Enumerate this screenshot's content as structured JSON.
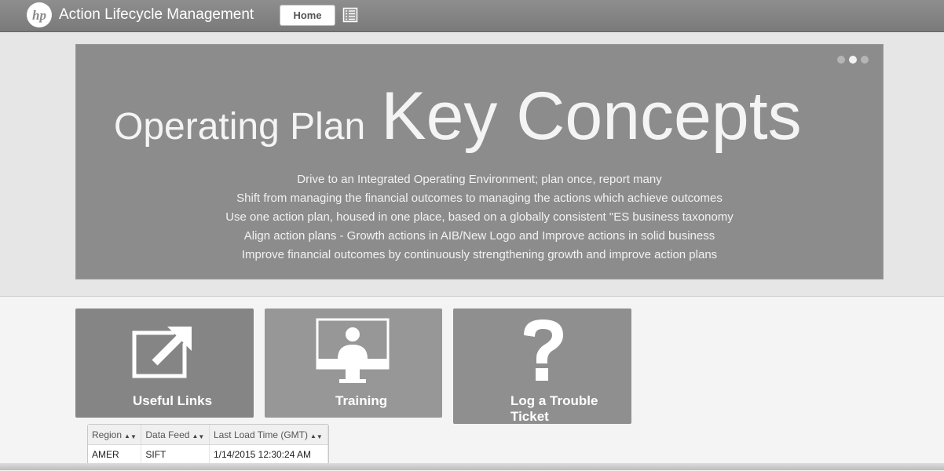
{
  "header": {
    "logo_text": "hp",
    "app_title": "Action Lifecycle Management",
    "home_label": "Home",
    "menu_icon": "list-icon"
  },
  "carousel": {
    "slide_count": 3,
    "active_slide": 2,
    "headline_small": "Operating Plan",
    "headline_large": "Key Concepts",
    "bullets": [
      "Drive to an Integrated Operating Environment; plan once, report many",
      "Shift from managing the financial outcomes to managing the actions which achieve outcomes",
      "Use one action plan, housed in one place, based on a globally consistent \"ES business taxonomy",
      "Align action plans - Growth actions in AIB/New Logo and Improve actions in solid business",
      "Improve financial outcomes by continuously strengthening growth and improve action plans"
    ]
  },
  "tiles": [
    {
      "label": "Useful Links",
      "icon": "external-link-icon"
    },
    {
      "label": "Training",
      "icon": "monitor-presenter-icon"
    },
    {
      "label_line1": "Log a Trouble",
      "label_line2": "Ticket",
      "icon": "question-mark-icon"
    }
  ],
  "feed_table": {
    "columns": [
      "Region",
      "Data Feed",
      "Last Load Time (GMT)"
    ],
    "rows": [
      [
        "AMER",
        "SIFT",
        "1/14/2015 12:30:24 AM"
      ]
    ]
  }
}
